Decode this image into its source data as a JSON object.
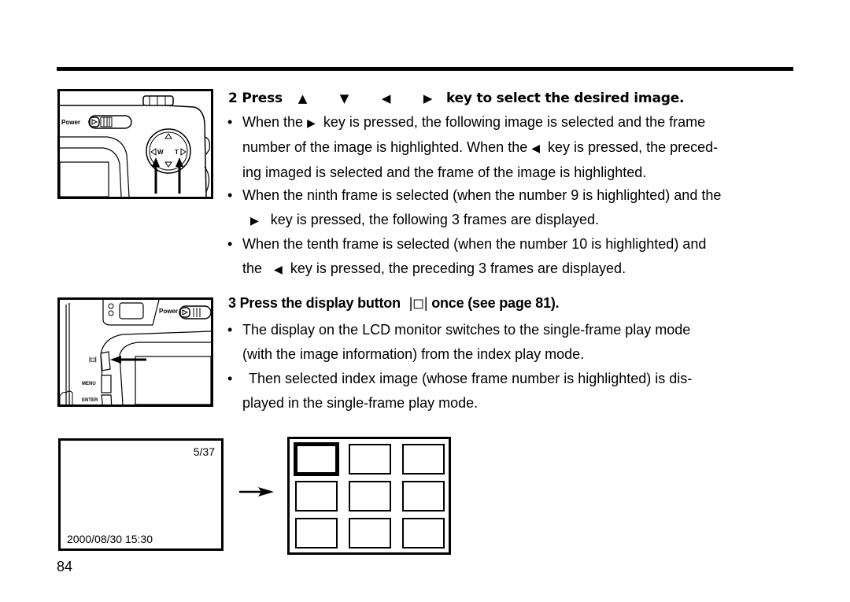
{
  "page": {
    "number": "84"
  },
  "illustrations": {
    "camera_top": {
      "power_label": "Power",
      "dial_w": "W",
      "dial_t": "T"
    },
    "camera_back": {
      "power_label": "Power",
      "display_button_label": "|◻|",
      "menu_label": "MENU",
      "enter_label": "ENTER"
    }
  },
  "step2": {
    "number": "2",
    "press": "Press",
    "keys": [
      "▲",
      "▼",
      "◀",
      "▶"
    ],
    "heading_tail": "key to select the desired image.",
    "bullets": [
      {
        "lines": [
          [
            "When the",
            "▶",
            "key is pressed, the following image is selected and the frame"
          ],
          [
            "number of the image is highlighted. When the",
            "◀",
            "key is pressed, the preced-"
          ],
          [
            "ing imaged is selected and the frame of the image is highlighted."
          ]
        ]
      },
      {
        "lines": [
          [
            "When the ninth frame is selected (when the number 9 is highlighted) and the"
          ],
          [
            "",
            "▶",
            "key is pressed, the following 3 frames are displayed."
          ]
        ]
      },
      {
        "lines": [
          [
            "When the tenth frame is selected (when the number 10 is highlighted) and"
          ],
          [
            "the",
            "◀",
            "key is pressed, the preceding 3 frames are displayed."
          ]
        ]
      }
    ]
  },
  "step3": {
    "number": "3",
    "heading_pre": "Press the display button",
    "button_symbol": "|◻|",
    "heading_post": "once (see page 81).",
    "bullets": [
      {
        "lines": [
          "The display on the LCD monitor switches to the single-frame play mode",
          "(with the image information) from the index play mode."
        ]
      },
      {
        "lines": [
          "Then selected index image (whose frame number is highlighted) is dis-",
          "played in the single-frame play mode."
        ]
      }
    ]
  },
  "lcd_single": {
    "frame_count": "5/37",
    "datetime": "2000/08/30 15:30"
  },
  "lcd_index": {
    "rows": 3,
    "cols": 3,
    "selected_index": 0
  },
  "bullet_char": "•",
  "arrow_symbol": "→"
}
